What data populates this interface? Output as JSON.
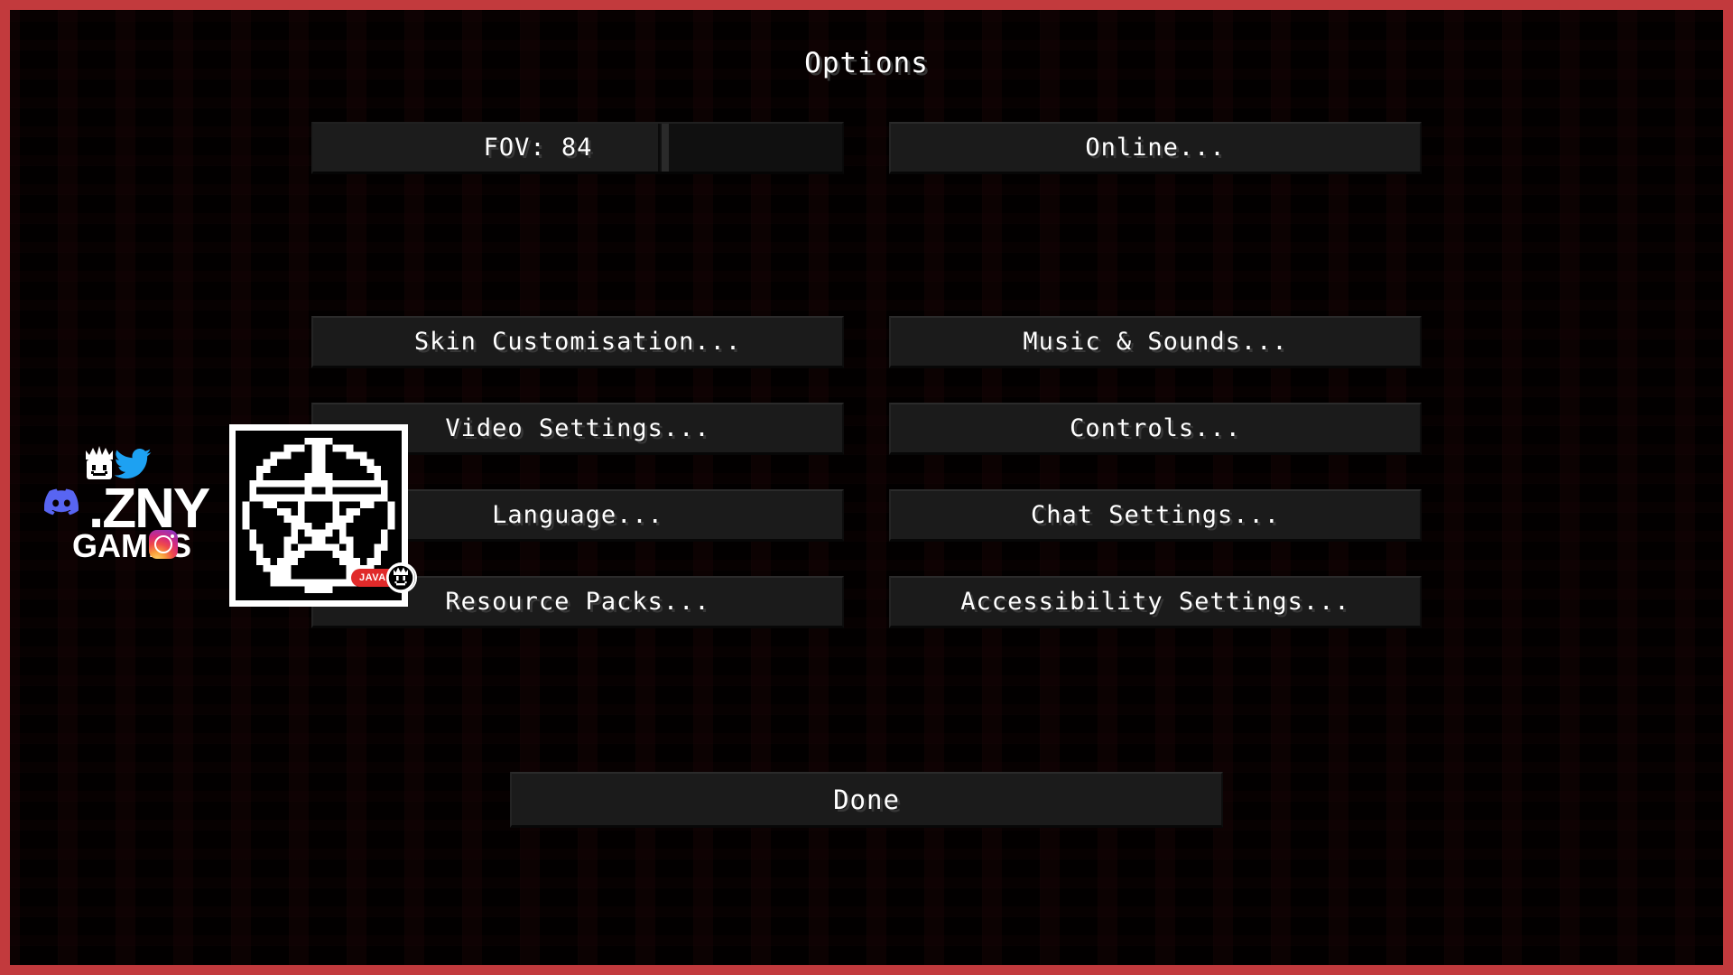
{
  "window": {
    "title": "Options",
    "border_color": "#c23a3d",
    "background_color": "#070102"
  },
  "slider": {
    "name": "fov-slider",
    "label": "FOV: 84",
    "value": 84,
    "min": 30,
    "max": 110,
    "fill_percent": 65
  },
  "buttons": {
    "online": "Online...",
    "skin_customisation": "Skin Customisation...",
    "music_and_sounds": "Music & Sounds...",
    "video_settings": "Video Settings...",
    "controls": "Controls...",
    "language": "Language...",
    "chat_settings": "Chat Settings...",
    "resource_packs": "Resource Packs...",
    "accessibility_settings": "Accessibility Settings...",
    "done": "Done"
  },
  "watermark": {
    "brand_line1": ".ZNY",
    "brand_line2": "GAMES",
    "icons": {
      "discord": "discord-icon",
      "twitter": "twitter-icon",
      "instagram": "instagram-icon",
      "crown": "crown-character-icon"
    },
    "colors": {
      "discord": "#5865F2",
      "twitter": "#1DA1F2",
      "instagram_accent": "#d4287c",
      "text": "#ffffff"
    }
  },
  "pixel_panel": {
    "name": "pixel-art-pentagram",
    "border_color": "#ffffff",
    "background_color": "#000000",
    "badge_text": "JAVA",
    "badge_color": "#e02a2a",
    "face_icon": "crown-face-icon"
  }
}
